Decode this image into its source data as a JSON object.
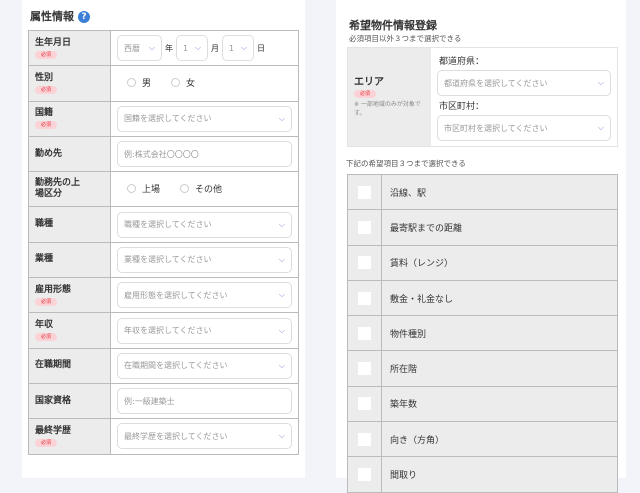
{
  "left": {
    "title": "属性情報",
    "help_icon": "?",
    "required_label": "必須",
    "birth": {
      "label": "生年月日",
      "era": "西暦",
      "year_unit": "年",
      "month": "1",
      "month_unit": "月",
      "day": "1",
      "day_unit": "日"
    },
    "gender": {
      "label": "性別",
      "options": [
        "男",
        "女"
      ]
    },
    "nationality": {
      "label": "国籍",
      "placeholder": "国籍を選択してください"
    },
    "employer": {
      "label": "勤め先",
      "placeholder": "例:株式会社〇〇〇〇"
    },
    "listing": {
      "label": "勤務先の上場区分",
      "options": [
        "上場",
        "その他"
      ]
    },
    "occupation": {
      "label": "職種",
      "placeholder": "職種を選択してください"
    },
    "industry": {
      "label": "業種",
      "placeholder": "業種を選択してください"
    },
    "employment": {
      "label": "雇用形態",
      "placeholder": "雇用形態を選択してください"
    },
    "income": {
      "label": "年収",
      "placeholder": "年収を選択してください"
    },
    "tenure": {
      "label": "在職期間",
      "placeholder": "在職期間を選択してください"
    },
    "qualification": {
      "label": "国家資格",
      "placeholder": "例:一級建築士"
    },
    "education": {
      "label": "最終学歴",
      "placeholder": "最終学歴を選択してください"
    }
  },
  "right": {
    "title": "希望物件情報登録",
    "subtitle": "必須項目以外３つまで選択できる",
    "area": {
      "label": "エリア",
      "required": "必須",
      "note": "※ 一部地域のみが対象です。",
      "pref_label": "都道府県：",
      "pref_placeholder": "都道府県を選択してください",
      "city_label": "市区町村：",
      "city_placeholder": "市区町村を選択してください"
    },
    "pref_caption": "下記の希望項目３つまで選択できる",
    "prefs": [
      "沿線、駅",
      "最寄駅までの距離",
      "賃料（レンジ）",
      "敷金・礼金なし",
      "物件種別",
      "所在階",
      "築年数",
      "向き（方角）",
      "間取り"
    ]
  }
}
